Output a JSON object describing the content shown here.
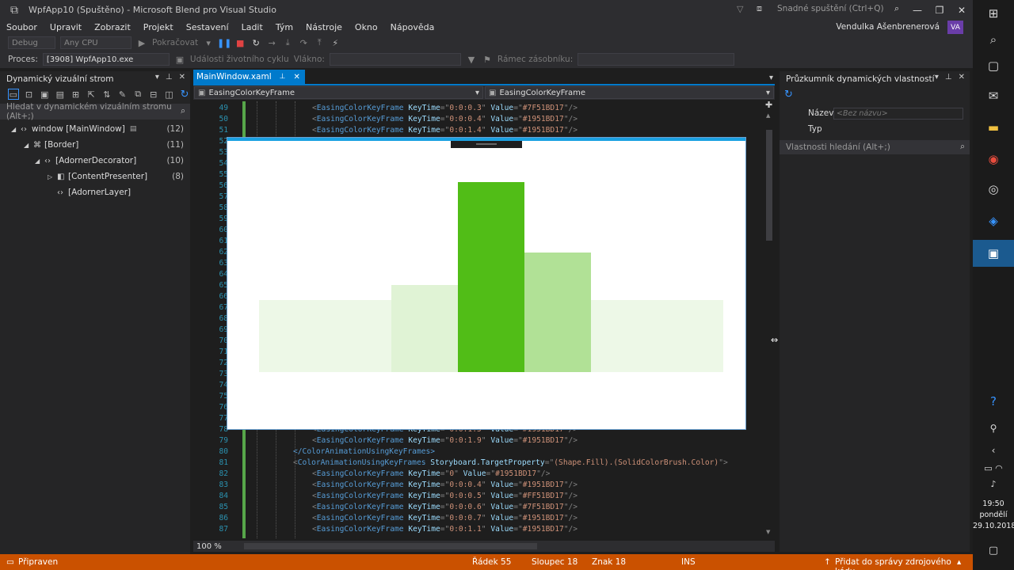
{
  "window": {
    "title": "WpfApp10 (Spuštěno) - Microsoft Blend pro Visual Studio",
    "quick_launch_placeholder": "Snadné spuštění (Ctrl+Q)",
    "user_name": "Vendulka Ašenbrenerová",
    "user_initials": "VA"
  },
  "menu": [
    "Soubor",
    "Upravit",
    "Zobrazit",
    "Projekt",
    "Sestavení",
    "Ladit",
    "Tým",
    "Nástroje",
    "Okno",
    "Nápověda"
  ],
  "toolbar": {
    "config": "Debug",
    "platform": "Any CPU",
    "continue_label": "Pokračovat",
    "process_label": "Proces:",
    "process_value": "[3908] WpfApp10.exe",
    "lifecycle_label": "Události životního cyklu",
    "thread_label": "Vlákno:",
    "stackframe_label": "Rámec zásobníku:"
  },
  "left_panel": {
    "title": "Dynamický vizuální strom",
    "search_placeholder": "Hledat v dynamickém vizuálním stromu (Alt+;)",
    "tree": [
      {
        "label": "window [MainWindow]",
        "count": "(12)",
        "indent": 0
      },
      {
        "label": "[Border]",
        "count": "(11)",
        "indent": 1
      },
      {
        "label": "[AdornerDecorator]",
        "count": "(10)",
        "indent": 2
      },
      {
        "label": "[ContentPresenter]",
        "count": "(8)",
        "indent": 3
      },
      {
        "label": "[AdornerLayer]",
        "count": "",
        "indent": 3
      }
    ]
  },
  "editor": {
    "tab_label": "MainWindow.xaml",
    "nav_left": "EasingColorKeyFrame",
    "nav_right": "EasingColorKeyFrame",
    "zoom": "100 %",
    "lines_top": [
      {
        "n": "49",
        "keytime": "0:0:0.3",
        "value": "#7F51BD17"
      },
      {
        "n": "50",
        "keytime": "0:0:0.4",
        "value": "#1951BD17"
      },
      {
        "n": "51",
        "keytime": "0:0:1.4",
        "value": "#1951BD17"
      }
    ],
    "lines_bottom": [
      {
        "n": "78",
        "kind": "kf",
        "keytime": "0:0:1.5",
        "value": "#1951BD17"
      },
      {
        "n": "79",
        "kind": "kf",
        "keytime": "0:0:1.9",
        "value": "#1951BD17"
      },
      {
        "n": "80",
        "kind": "close",
        "text": "</ColorAnimationUsingKeyFrames>"
      },
      {
        "n": "81",
        "kind": "open",
        "prop": "(Shape.Fill).(SolidColorBrush.Color)"
      },
      {
        "n": "82",
        "kind": "kf",
        "keytime": "0",
        "value": "#1951BD17"
      },
      {
        "n": "83",
        "kind": "kf",
        "keytime": "0:0:0.4",
        "value": "#1951BD17"
      },
      {
        "n": "84",
        "kind": "kf",
        "keytime": "0:0:0.5",
        "value": "#FF51BD17"
      },
      {
        "n": "85",
        "kind": "kf",
        "keytime": "0:0:0.6",
        "value": "#7F51BD17"
      },
      {
        "n": "86",
        "kind": "kf",
        "keytime": "0:0:0.7",
        "value": "#1951BD17"
      },
      {
        "n": "87",
        "kind": "kf",
        "keytime": "0:0:1.1",
        "value": "#1951BD17"
      }
    ],
    "hidden_line_numbers": [
      "52",
      "53",
      "54",
      "55",
      "56",
      "57",
      "58",
      "59",
      "60",
      "61",
      "62",
      "63",
      "64",
      "65",
      "66",
      "67",
      "68",
      "69",
      "70",
      "71",
      "72",
      "73",
      "74",
      "75",
      "76",
      "77"
    ],
    "element_name": "EasingColorKeyFrame",
    "attr_keytime": "KeyTime",
    "attr_value": "Value",
    "open_element": "ColorAnimationUsingKeyFrames",
    "open_attr": "Storyboard.TargetProperty"
  },
  "preview_app": {
    "bars": [
      {
        "fill": "#51BD17",
        "opacity": 0.1,
        "level": 0.38
      },
      {
        "fill": "#51BD17",
        "opacity": 0.18,
        "level": 0.46
      },
      {
        "fill": "#51BD17",
        "opacity": 1.0,
        "level": 1.0
      },
      {
        "fill": "#51BD17",
        "opacity": 0.45,
        "level": 0.63
      },
      {
        "fill": "#51BD17",
        "opacity": 0.1,
        "level": 0.38
      }
    ]
  },
  "right_panel": {
    "title": "Průzkumník dynamických vlastností",
    "name_label": "Název",
    "name_placeholder": "<Bez názvu>",
    "type_label": "Typ",
    "search_placeholder": "Vlastnosti hledání (Alt+;)"
  },
  "status": {
    "ready": "Připraven",
    "row": "Řádek 55",
    "col": "Sloupec 18",
    "char": "Znak 18",
    "ins": "INS",
    "source_control": "Přidat do správy zdrojového kódu"
  },
  "clock": {
    "time": "19:50",
    "day": "pondělí",
    "date": "29.10.2018"
  },
  "colors": {
    "accent": "#007acc",
    "status_bar": "#ca5100",
    "bar_green": "#51BD17"
  }
}
